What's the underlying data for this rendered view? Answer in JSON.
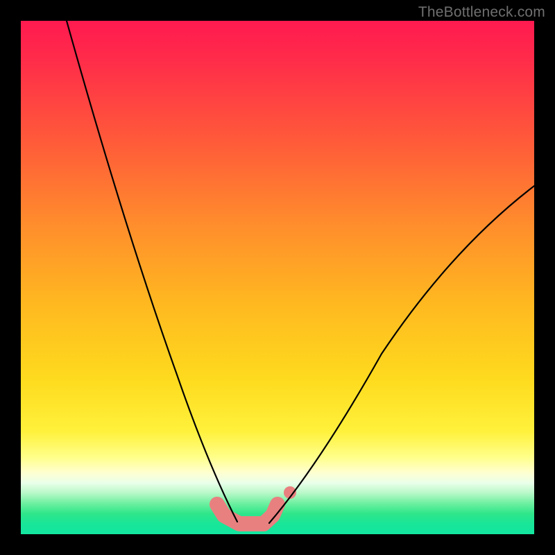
{
  "watermark": "TheBottleneck.com",
  "chart_data": {
    "type": "line",
    "title": "",
    "xlabel": "",
    "ylabel": "",
    "xlim": [
      0,
      100
    ],
    "ylim": [
      0,
      100
    ],
    "grid": false,
    "series": [
      {
        "name": "left-curve",
        "x": [
          9,
          15,
          20,
          25,
          30,
          35,
          38,
          40,
          42
        ],
        "y": [
          100,
          80,
          62,
          45,
          29,
          15,
          8,
          3,
          0
        ]
      },
      {
        "name": "right-curve",
        "x": [
          48,
          52,
          56,
          62,
          70,
          80,
          90,
          100
        ],
        "y": [
          0,
          3,
          8,
          17,
          30,
          45,
          58,
          68
        ]
      }
    ],
    "optimal_band": {
      "x": [
        38,
        40,
        42,
        45,
        48,
        50
      ],
      "y": [
        3,
        1,
        0,
        0,
        1,
        3
      ]
    }
  }
}
